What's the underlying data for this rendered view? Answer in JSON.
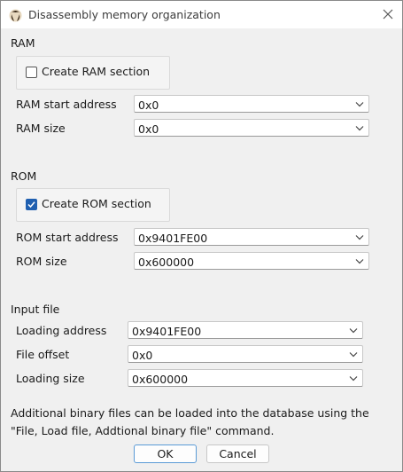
{
  "window": {
    "title": "Disassembly memory organization"
  },
  "ram": {
    "section_label": "RAM",
    "create_label": "Create RAM section",
    "create_checked": false,
    "start_label": "RAM start address",
    "start_value": "0x0",
    "size_label": "RAM size",
    "size_value": "0x0"
  },
  "rom": {
    "section_label": "ROM",
    "create_label": "Create ROM section",
    "create_checked": true,
    "start_label": "ROM start address",
    "start_value": "0x9401FE00",
    "size_label": "ROM size",
    "size_value": "0x600000"
  },
  "input_file": {
    "section_label": "Input file",
    "loading_address_label": "Loading address",
    "loading_address_value": "0x9401FE00",
    "file_offset_label": "File offset",
    "file_offset_value": "0x0",
    "loading_size_label": "Loading size",
    "loading_size_value": "0x600000"
  },
  "note": {
    "line1": "Additional binary files can be loaded into the database using the",
    "line2": "\"File, Load file, Addtional binary file\" command."
  },
  "buttons": {
    "ok": "OK",
    "cancel": "Cancel"
  },
  "colors": {
    "accent": "#1f5fb0",
    "background": "#f0f0f0"
  },
  "icons": {
    "app": "ida-app-icon",
    "close": "close-icon",
    "dropdown": "chevron-down-icon",
    "check": "checkmark-icon"
  }
}
